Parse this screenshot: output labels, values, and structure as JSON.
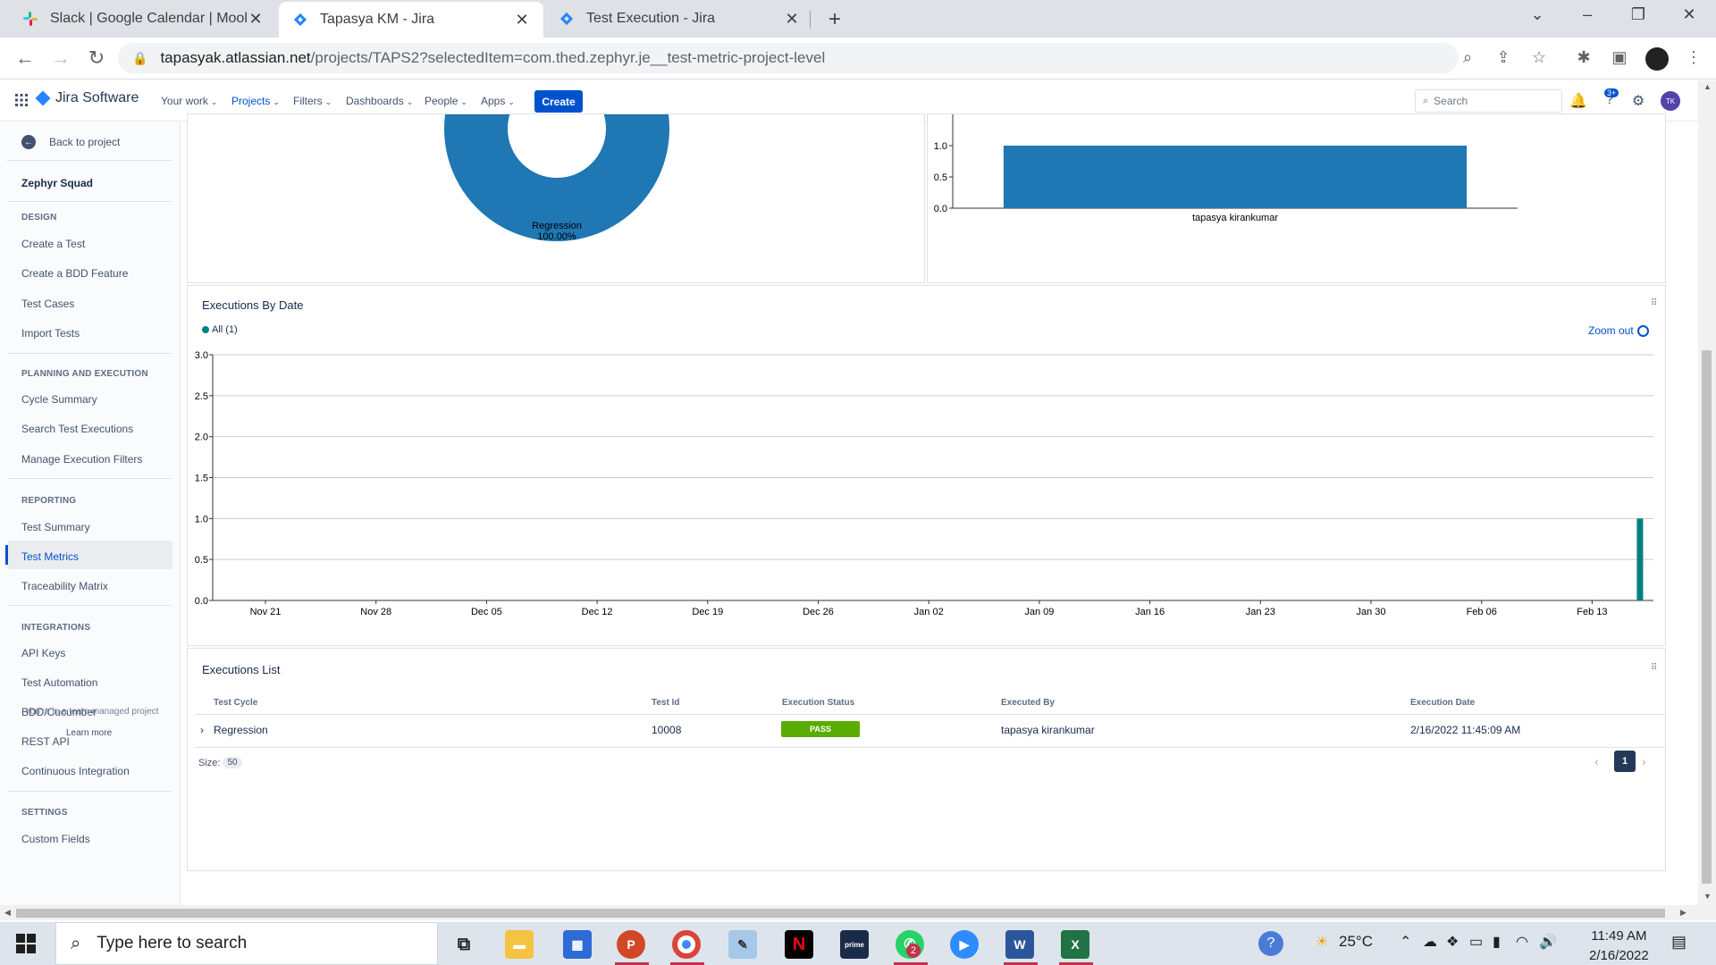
{
  "browser": {
    "tabs": [
      {
        "title": "Slack | Google Calendar | Moolya",
        "active": false
      },
      {
        "title": "Tapasya KM - Jira",
        "active": true
      },
      {
        "title": "Test Execution - Jira",
        "active": false
      }
    ],
    "url_host": "tapasyak.atlassian.net",
    "url_path": "/projects/TAPS2?selectedItem=com.thed.zephyr.je__test-metric-project-level"
  },
  "jira": {
    "product": "Jira Software",
    "nav": [
      "Your work",
      "Projects",
      "Filters",
      "Dashboards",
      "People",
      "Apps"
    ],
    "active_nav": "Projects",
    "create_label": "Create",
    "search_placeholder": "Search",
    "help_badge": "3+",
    "user_initials": "TK"
  },
  "sidebar": {
    "back": "Back to project",
    "title": "Zephyr Squad",
    "sections": [
      {
        "label": "DESIGN",
        "items": [
          "Create a Test",
          "Create a BDD Feature",
          "Test Cases",
          "Import Tests"
        ]
      },
      {
        "label": "PLANNING AND EXECUTION",
        "items": [
          "Cycle Summary",
          "Search Test Executions",
          "Manage Execution Filters"
        ]
      },
      {
        "label": "REPORTING",
        "items": [
          "Test Summary",
          "Test Metrics",
          "Traceability Matrix"
        ]
      },
      {
        "label": "INTEGRATIONS",
        "items": [
          "API Keys",
          "Test Automation",
          "BDD/Cucumber",
          "REST API",
          "Continuous Integration"
        ]
      },
      {
        "label": "SETTINGS",
        "items": [
          "Custom Fields"
        ]
      }
    ],
    "active_item": "Test Metrics",
    "overlay_text": "You're in a team-managed project",
    "learn_more": "Learn more"
  },
  "donut": {
    "label": "Regression",
    "percent": "100.00%"
  },
  "bar_chart": {
    "type": "bar",
    "categories": [
      "tapasya kirankumar"
    ],
    "values": [
      1.0
    ],
    "yticks": [
      "0.0",
      "0.5",
      "1.0"
    ],
    "ylim": [
      0,
      1.0
    ]
  },
  "executions_by_date": {
    "title": "Executions By Date",
    "legend": "All (1)",
    "zoom_out": "Zoom out",
    "chart_data": {
      "type": "bar",
      "x": [
        "Nov 21",
        "Nov 28",
        "Dec 05",
        "Dec 12",
        "Dec 19",
        "Dec 26",
        "Jan 02",
        "Jan 09",
        "Jan 16",
        "Jan 23",
        "Jan 30",
        "Feb 06",
        "Feb 13"
      ],
      "series": [
        {
          "name": "All (1)",
          "points": [
            {
              "x": "Feb 16",
              "y": 1
            }
          ]
        }
      ],
      "yticks": [
        "0.0",
        "0.5",
        "1.0",
        "1.5",
        "2.0",
        "2.5",
        "3.0"
      ],
      "ylim": [
        0,
        3.0
      ],
      "color": "#008080"
    }
  },
  "executions_list": {
    "title": "Executions List",
    "headers": [
      "Test Cycle",
      "Test Id",
      "Execution Status",
      "Executed By",
      "Execution Date"
    ],
    "rows": [
      {
        "cycle": "Regression",
        "test_id": "10008",
        "status": "PASS",
        "executed_by": "tapasya kirankumar",
        "date": "2/16/2022 11:45:09 AM"
      }
    ],
    "size_label": "Size:",
    "size_value": "50",
    "current_page": "1"
  },
  "taskbar": {
    "search_placeholder": "Type here to search",
    "temperature": "25°C",
    "time": "11:49 AM",
    "date": "2/16/2022",
    "whatsapp_badge": "2"
  },
  "colors": {
    "primary": "#0052cc",
    "chart_blue": "#1f77b4",
    "teal": "#008080",
    "pass_green": "#5aac00"
  }
}
